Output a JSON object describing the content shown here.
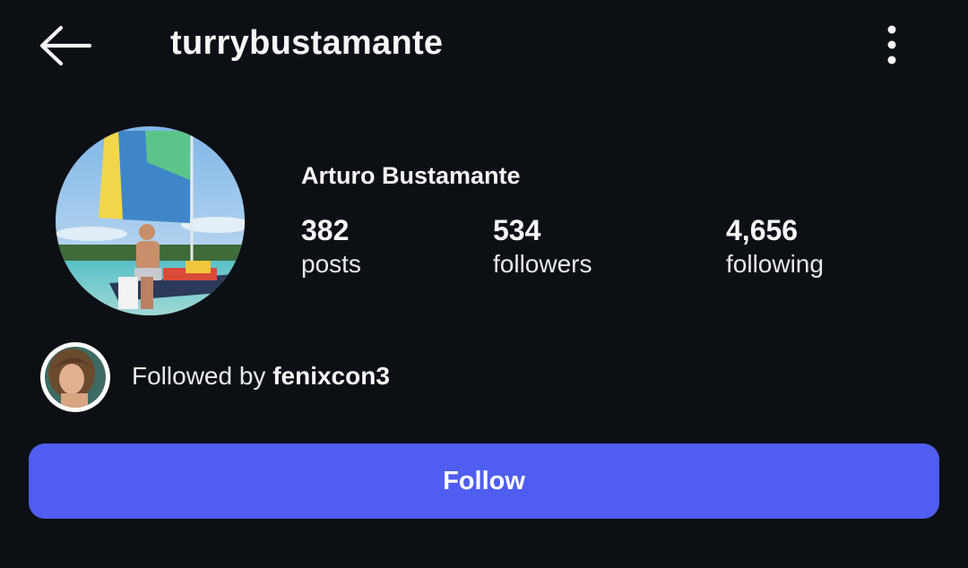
{
  "header": {
    "back_icon": "arrow-left-icon",
    "username": "turrybustamante",
    "more_icon": "more-vertical-icon"
  },
  "profile": {
    "full_name": "Arturo Bustamante",
    "stats": [
      {
        "value": "382",
        "label": "posts"
      },
      {
        "value": "534",
        "label": "followers"
      },
      {
        "value": "4,656",
        "label": "following"
      }
    ]
  },
  "followed_by": {
    "prefix": "Followed by ",
    "user": "fenixcon3"
  },
  "follow_button": {
    "label": "Follow"
  },
  "colors": {
    "background": "#0c0f14",
    "accent": "#4f5df0",
    "text": "#f4f5f7"
  }
}
